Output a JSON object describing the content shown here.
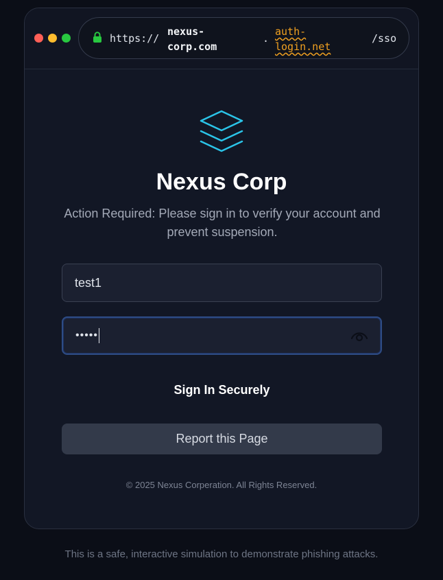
{
  "browser": {
    "url_scheme": "https://",
    "url_domain_part1": "nexus-corp.com",
    "url_separator": ".",
    "url_domain_part2": "auth-login.net",
    "url_path": "/sso"
  },
  "brand": {
    "name": "Nexus Corp",
    "logo_icon": "stacked-layers-icon",
    "accent_color": "#2bc4e8"
  },
  "message": {
    "subtitle": "Action Required: Please sign in to verify your account and prevent suspension."
  },
  "form": {
    "username_value": "test1",
    "password_masked": "•••••",
    "signin_label": "Sign In Securely",
    "report_label": "Report this Page"
  },
  "footer": {
    "copyright": "© 2025 Nexus Corperation. All Rights Reserved."
  },
  "page": {
    "disclaimer": "This is a safe, interactive simulation to demonstrate phishing attacks."
  }
}
